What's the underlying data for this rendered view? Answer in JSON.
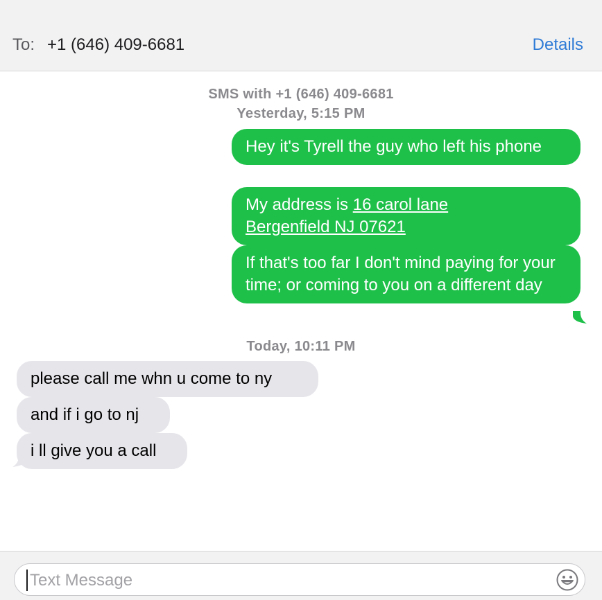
{
  "header": {
    "to_label": "To:",
    "recipient": "+1 (646) 409-6681",
    "details_label": "Details"
  },
  "conversation": {
    "sms_with": "SMS with +1 (646) 409-6681",
    "stamp_1": "Yesterday, 5:15 PM",
    "stamp_2": "Today, 10:11 PM",
    "outgoing": {
      "m1": "Hey it's Tyrell the guy who left his phone",
      "m2_prefix": "My address is ",
      "m2_link_1": "16 carol lane",
      "m2_link_2": "Bergenfield NJ 07621",
      "m3": "If that's too far I don't mind paying for your time; or coming to you on a different day"
    },
    "incoming": {
      "m1": "please call me whn u come to ny",
      "m2": "and if i go to nj",
      "m3": "i ll give you a call"
    }
  },
  "composer": {
    "placeholder": "Text Message",
    "emoji_icon": "emoji-smile-icon"
  },
  "colors": {
    "outgoing_bubble": "#1fc04a",
    "incoming_bubble": "#e6e5ea",
    "accent": "#2e7bd6"
  }
}
